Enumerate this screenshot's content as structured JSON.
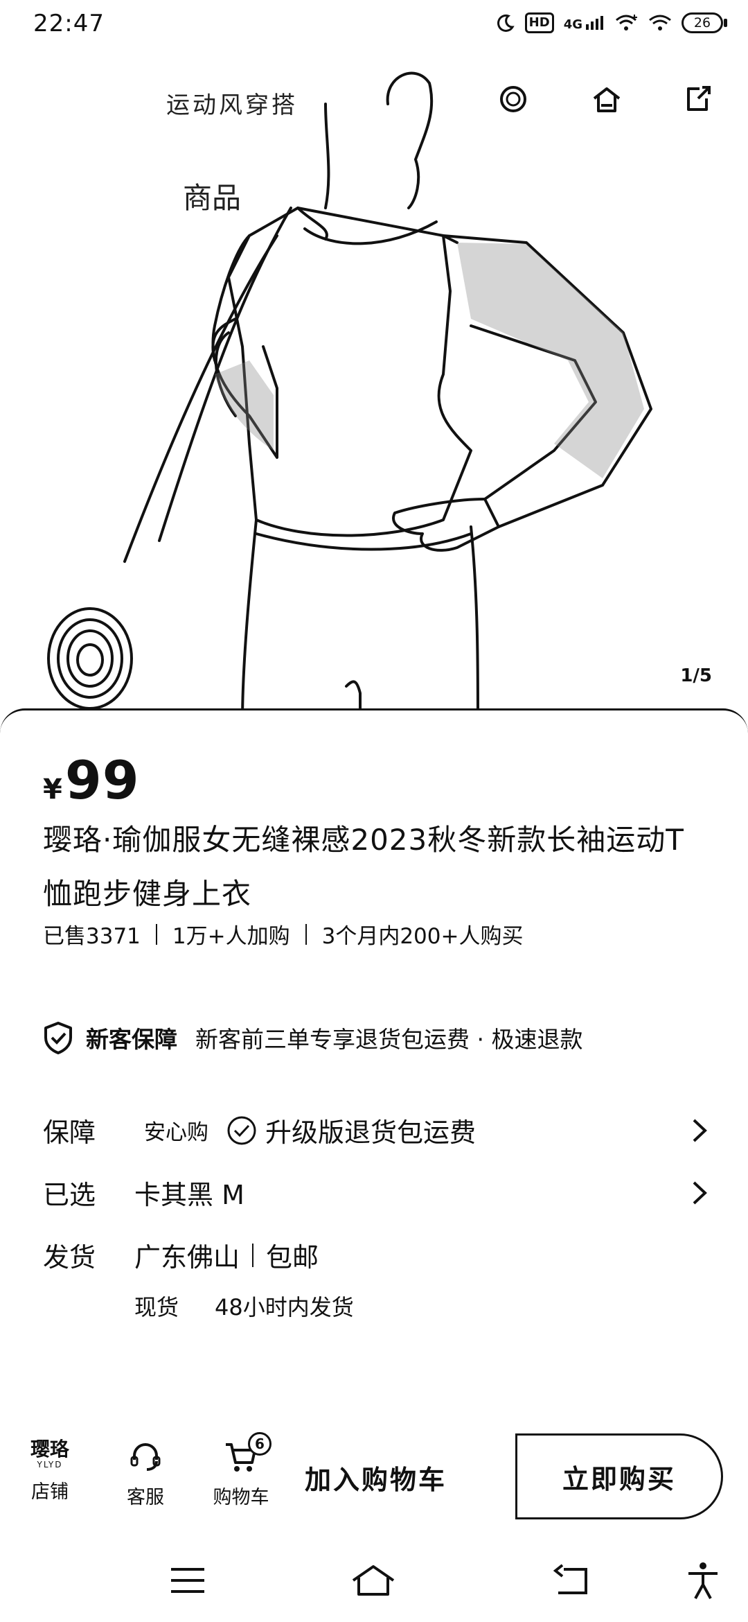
{
  "status_bar": {
    "time": "22:47",
    "network": "4G",
    "hd": "HD",
    "battery": "26",
    "icons": [
      "moon-icon",
      "hd-icon",
      "signal-icon",
      "wifi-plus-icon",
      "wifi-icon",
      "battery-icon"
    ]
  },
  "hero": {
    "title": "运动风穿搭",
    "tab": "商品",
    "pager": "1/5",
    "buttons": [
      "search-icon",
      "home-icon",
      "share-icon"
    ]
  },
  "product": {
    "currency": "¥",
    "price": "99",
    "title": "璎珞·瑜伽服女无缝裸感2023秋冬新款长袖运动T恤跑步健身上衣",
    "sold": "已售3371",
    "added": "1万+人加购",
    "bought": "3个月内200+人购买"
  },
  "guarantee": {
    "title": "新客保障",
    "text": "新客前三单专享退货包运费 · 极速退款"
  },
  "rows": {
    "safe": {
      "label": "保障",
      "tag": "安心购",
      "value": "升级版退货包运费"
    },
    "selected": {
      "label": "已选",
      "value": "卡其黑 M"
    },
    "ship": {
      "label": "发货",
      "origin": "广东佛山",
      "free": "包邮",
      "stock": "现货",
      "time": "48小时内发货"
    }
  },
  "actions": {
    "shop_logo": "璎珞",
    "shop_logo_sub": "YLYD",
    "shop": "店铺",
    "service": "客服",
    "cart": "购物车",
    "cart_count": "6",
    "add_to_cart": "加入购物车",
    "buy_now": "立即购买"
  }
}
